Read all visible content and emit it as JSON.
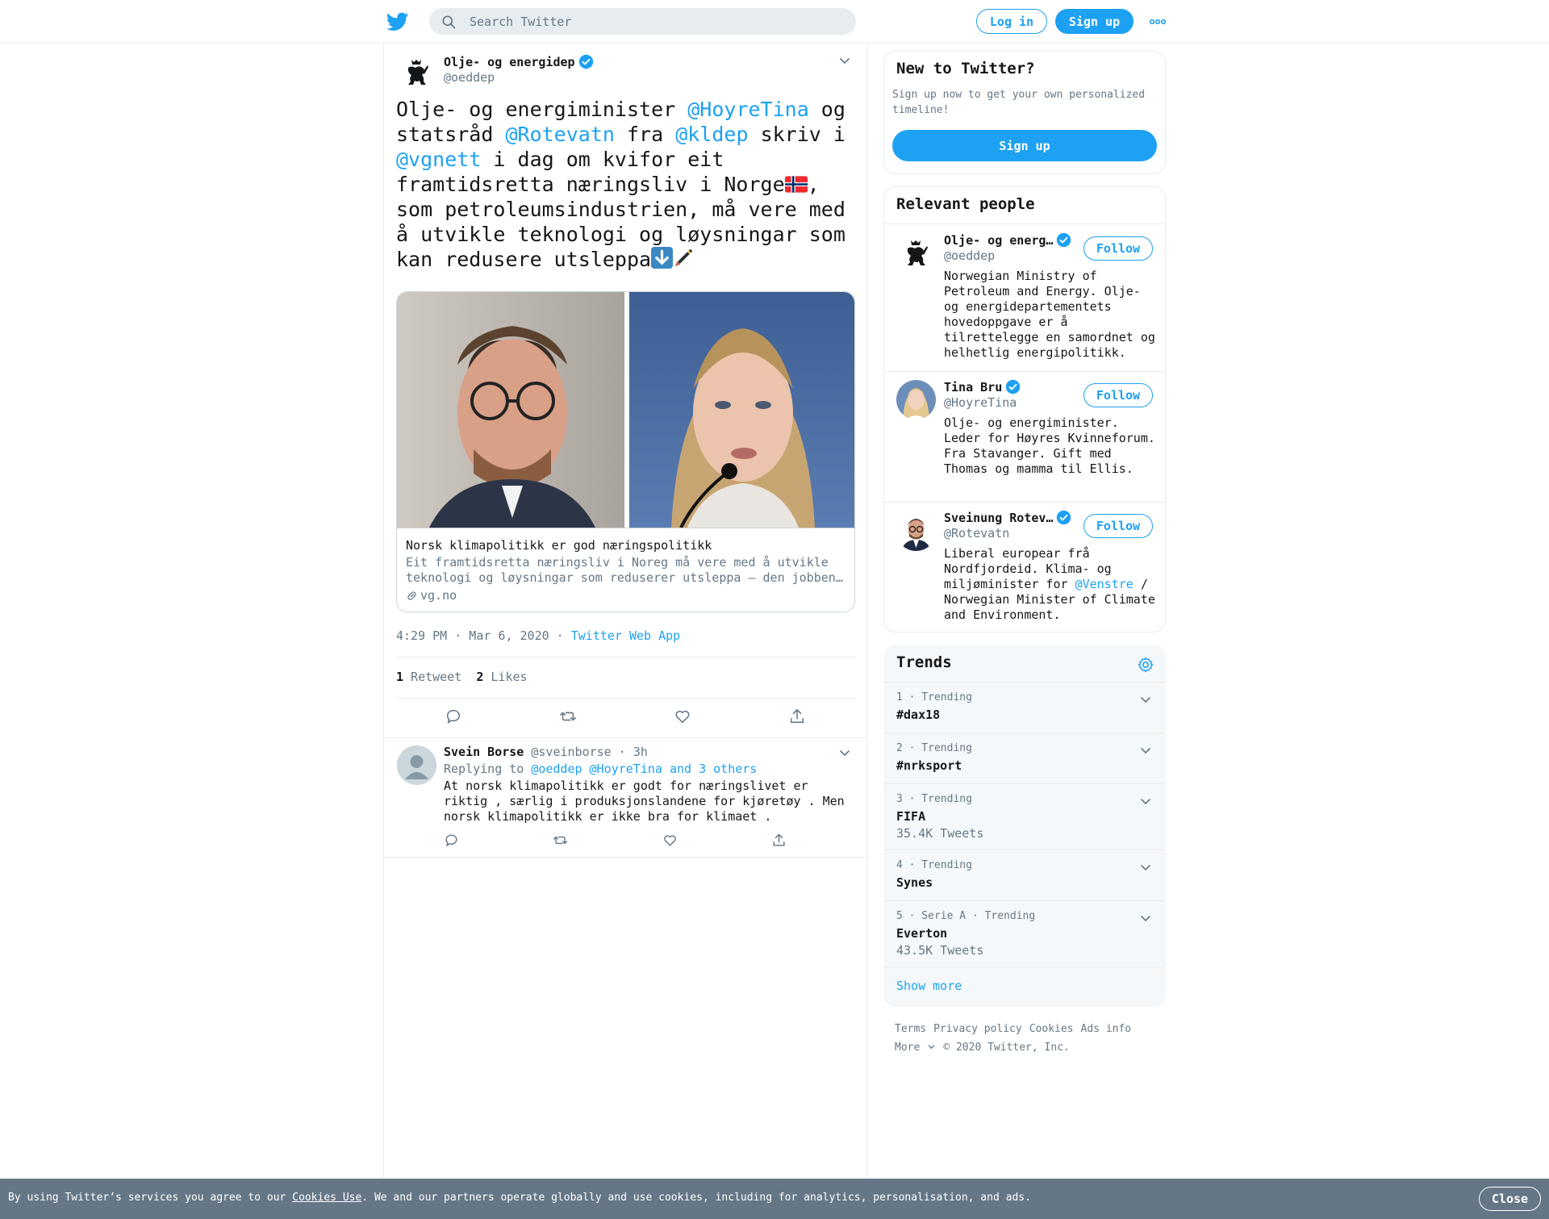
{
  "header": {
    "search_placeholder": "Search Twitter",
    "login_label": "Log in",
    "signup_label": "Sign up"
  },
  "tweet": {
    "author_name": "Olje- og energidep",
    "author_handle": "@oeddep",
    "text_parts": {
      "p1": "Olje- og energiminister ",
      "m1": "@HoyreTina",
      "p2": " og statsråd ",
      "m2": "@Rotevatn",
      "p3": " fra ",
      "m3": "@kldep",
      "p4": " skriv i ",
      "m4": "@vgnett",
      "p5": " i dag om kvifor eit framtidsretta næringsliv i Norge",
      "flag": "🇳🇴",
      "p6": ", som petroleumsindustrien, må vere med å utvikle teknologi og løysningar som kan redusere utsleppa",
      "emoji": "⬇️🖋️"
    },
    "card": {
      "title": "Norsk klimapolitikk er god næringspolitikk",
      "description": "Eit framtidsretta næringsliv i Noreg må vere med å utvikle teknologi og løysningar som reduserer utsleppa – den jobben…",
      "domain": "vg.no"
    },
    "time": "4:29 PM · Mar 6, 2020",
    "source": "Twitter Web App",
    "retweets_count": "1",
    "retweets_label": "Retweet",
    "likes_count": "2",
    "likes_label": "Likes"
  },
  "reply": {
    "name": "Svein Borse",
    "handle": "@sveinborse",
    "time": "3h",
    "replying_label": "Replying to",
    "replying_to": "@oeddep @HoyreTina and 3 others",
    "text": "At norsk klimapolitikk er godt for  næringslivet er riktig , særlig i produksjonslandene for kjøretøy . Men norsk klimapolitikk er ikke bra for klimaet ."
  },
  "sidebar": {
    "new_title": "New to Twitter?",
    "new_text": "Sign up now to get your own personalized timeline!",
    "new_signup": "Sign up",
    "relevant_title": "Relevant people",
    "follow_label": "Follow",
    "people": [
      {
        "name": "Olje- og energ…",
        "handle": "@oeddep",
        "bio": "Norwegian Ministry of Petroleum and Energy. Olje- og energidepartementets hovedoppgave er å tilrettelegge en samordnet og helhetlig energipolitikk."
      },
      {
        "name": "Tina Bru",
        "handle": "@HoyreTina",
        "bio": "Olje- og energiminister. Leder for Høyres Kvinneforum. Fra Stavanger. Gift med Thomas og mamma til Ellis."
      },
      {
        "name": "Sveinung Rotev…",
        "handle": "@Rotevatn",
        "bio_pre": "Liberal europear frå Nordfjordeid. Klima- og miljøminister for ",
        "bio_link": "@Venstre",
        "bio_post": " / Norwegian Minister of Climate and Environment."
      }
    ],
    "trends_title": "Trends",
    "trends": [
      {
        "context": "1 · Trending",
        "name": "#dax18",
        "count": ""
      },
      {
        "context": "2 · Trending",
        "name": "#nrksport",
        "count": ""
      },
      {
        "context": "3 · Trending",
        "name": "FIFA",
        "count": "35.4K Tweets"
      },
      {
        "context": "4 · Trending",
        "name": "Synes",
        "count": ""
      },
      {
        "context": "5 · Serie A · Trending",
        "name": "Everton",
        "count": "43.5K Tweets"
      }
    ],
    "show_more": "Show more"
  },
  "footer": {
    "terms": "Terms",
    "privacy": "Privacy policy",
    "cookies": "Cookies",
    "ads": "Ads info",
    "more": "More",
    "copyright": "© 2020 Twitter, Inc."
  },
  "cookie": {
    "text_pre": "By using Twitter’s services you agree to our ",
    "link": "Cookies Use",
    "text_post": ". We and our partners operate globally and use cookies, including for analytics, personalisation, and ads.",
    "close": "Close"
  },
  "colors": {
    "brand": "#1da1f2",
    "text": "#14171a",
    "secondary": "#657786",
    "border": "#e6ecf0"
  }
}
